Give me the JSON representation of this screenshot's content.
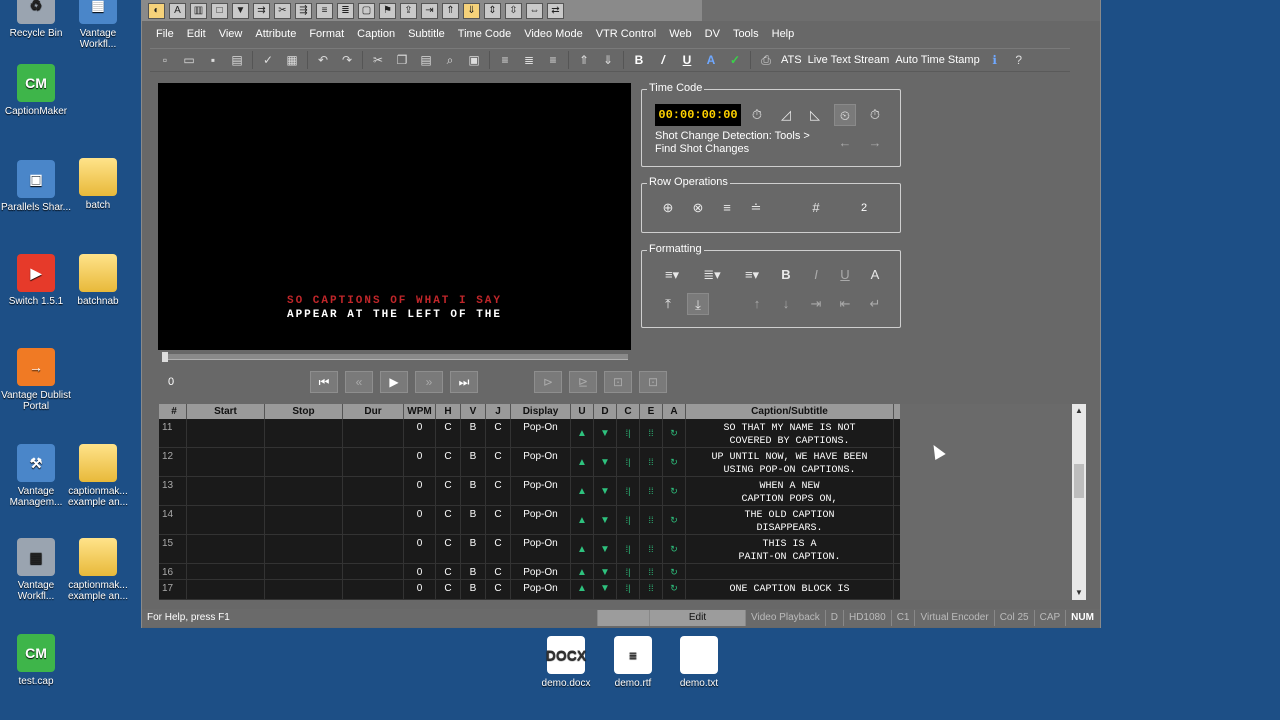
{
  "desktop": {
    "icons": [
      {
        "label": "Recycle Bin",
        "glyph": "recycle-bin-icon"
      },
      {
        "label": "Vantage Workfl...",
        "glyph": "vantage-workflow-icon"
      },
      {
        "label": "CaptionMaker",
        "glyph": "CM"
      },
      {
        "label": "Parallels Shar...",
        "glyph": "parallels-icon"
      },
      {
        "label": "batch",
        "glyph": "folder-icon"
      },
      {
        "label": "Switch 1.5.1",
        "glyph": "switch-icon"
      },
      {
        "label": "batchnab",
        "glyph": "folder-icon"
      },
      {
        "label": "Vantage Dublist Portal",
        "glyph": "vantage-dublist-icon"
      },
      {
        "label": "Vantage Managem...",
        "glyph": "vantage-management-icon"
      },
      {
        "label": "captionmak... example an...",
        "glyph": "folder-icon"
      },
      {
        "label": "Vantage Workfl...",
        "glyph": "vantage-workflow-icon"
      },
      {
        "label": "captionmak... example an...",
        "glyph": "folder-icon"
      },
      {
        "label": "test.cap",
        "glyph": "CM"
      },
      {
        "label": "demo.docx",
        "glyph": "DOCX"
      },
      {
        "label": "demo.rtf",
        "glyph": "rtf-file-icon"
      },
      {
        "label": "demo.txt",
        "glyph": "txt-file-icon"
      }
    ]
  },
  "menu": [
    "File",
    "Edit",
    "View",
    "Attribute",
    "Format",
    "Caption",
    "Subtitle",
    "Time Code",
    "Video Mode",
    "VTR Control",
    "Web",
    "DV",
    "Tools",
    "Help"
  ],
  "toolbar": {
    "ats": "ATS",
    "live_text_stream": "Live Text Stream",
    "auto_time_stamp": "Auto Time Stamp"
  },
  "video": {
    "caption_line1": "SO CAPTIONS OF WHAT I SAY",
    "caption_line2": "APPEAR AT THE LEFT OF THE",
    "caption_line1_color": "#c0262a",
    "position": "0"
  },
  "timecode": {
    "title": "Time Code",
    "value": "00:00:00:00",
    "hint_line1": "Shot Change Detection: Tools >",
    "hint_line2": "Find Shot Changes"
  },
  "row_ops": {
    "title": "Row Operations",
    "hash": "#",
    "count": "2"
  },
  "formatting": {
    "title": "Formatting"
  },
  "grid": {
    "columns": [
      "#",
      "Start",
      "Stop",
      "Dur",
      "WPM",
      "H",
      "V",
      "J",
      "Display",
      "U",
      "D",
      "C",
      "E",
      "A",
      "Caption/Subtitle"
    ],
    "rows": [
      {
        "num": "11",
        "wpm": "0",
        "h": "C",
        "v": "B",
        "j": "C",
        "display": "Pop-On",
        "cap1": "SO THAT MY NAME IS NOT",
        "cap2": "COVERED BY CAPTIONS."
      },
      {
        "num": "12",
        "wpm": "0",
        "h": "C",
        "v": "B",
        "j": "C",
        "display": "Pop-On",
        "cap1": "UP UNTIL NOW, WE HAVE BEEN",
        "cap2": "USING POP-ON CAPTIONS."
      },
      {
        "num": "13",
        "wpm": "0",
        "h": "C",
        "v": "B",
        "j": "C",
        "display": "Pop-On",
        "cap1": "WHEN A NEW",
        "cap2": "CAPTION POPS ON,"
      },
      {
        "num": "14",
        "wpm": "0",
        "h": "C",
        "v": "B",
        "j": "C",
        "display": "Pop-On",
        "cap1": "THE OLD CAPTION",
        "cap2": "DISAPPEARS."
      },
      {
        "num": "15",
        "wpm": "0",
        "h": "C",
        "v": "B",
        "j": "C",
        "display": "Pop-On",
        "cap1": "THIS IS A",
        "cap2": "PAINT-ON CAPTION."
      },
      {
        "num": "16",
        "wpm": "0",
        "h": "C",
        "v": "B",
        "j": "C",
        "display": "Pop-On",
        "cap1": "",
        "cap2": ""
      },
      {
        "num": "17",
        "wpm": "0",
        "h": "C",
        "v": "B",
        "j": "C",
        "display": "Pop-On",
        "cap1": "ONE CAPTION BLOCK IS",
        "cap2": ""
      }
    ]
  },
  "status": {
    "help": "For Help, press F1",
    "mode": "Edit",
    "playback": "Video Playback",
    "d": "D",
    "format": "HD1080",
    "channel": "C1",
    "encoder": "Virtual Encoder",
    "col": "Col 25",
    "cap": "CAP",
    "num": "NUM"
  }
}
